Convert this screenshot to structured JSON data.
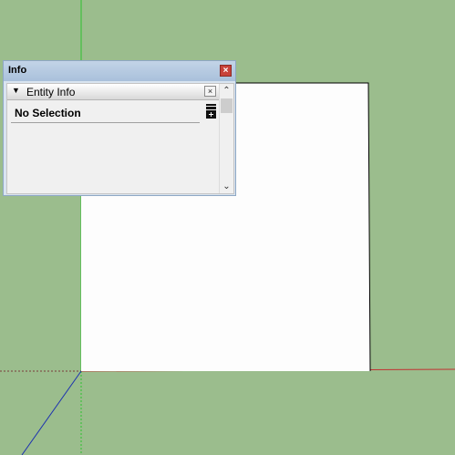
{
  "colors": {
    "background": "#9bbd8d",
    "green_axis": "#2ec12e",
    "red_axis": "#c23232",
    "blue_axis": "#1a2fb0",
    "face": "#fdfdfd",
    "edge": "#000000"
  },
  "info_panel": {
    "title": "Info",
    "close_icon": "×",
    "section": {
      "collapse_arrow": "▼",
      "label": "Entity Info",
      "close_icon": "×"
    },
    "selection_text": "No Selection",
    "toggle_details_icon": "details-toggle-icon",
    "scroll_up_icon": "⌃",
    "scroll_down_icon": "⌄"
  }
}
